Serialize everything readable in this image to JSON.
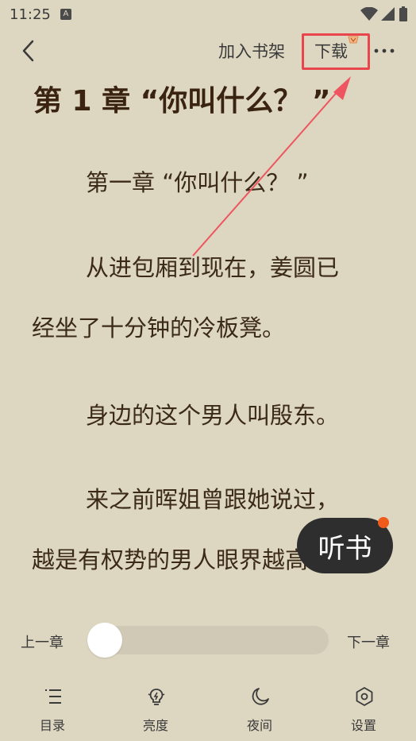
{
  "status": {
    "time": "11:25",
    "notification_icon": "A"
  },
  "toolbar": {
    "add_to_shelf": "加入书架",
    "download": "下载"
  },
  "chapter": {
    "title": "第 1 章 “你叫什么？ ”",
    "lines": [
      "第一章 “你叫什么？ ”",
      "从进包厢到现在，姜圆已",
      "经坐了十分钟的冷板凳。",
      "身边的这个男人叫殷东。",
      "来之前晖姐曾跟她说过，",
      "越是有权势的男人眼界越高。"
    ]
  },
  "listen": {
    "label": "听书"
  },
  "progress": {
    "prev": "上一章",
    "next": "下一章",
    "value": 0
  },
  "nav": [
    {
      "label": "目录",
      "icon": "list-icon"
    },
    {
      "label": "亮度",
      "icon": "brightness-icon"
    },
    {
      "label": "夜间",
      "icon": "moon-icon"
    },
    {
      "label": "设置",
      "icon": "settings-icon"
    }
  ],
  "colors": {
    "background": "#ddd6c1",
    "highlight": "#e8454c",
    "badge": "#f05a1a"
  }
}
